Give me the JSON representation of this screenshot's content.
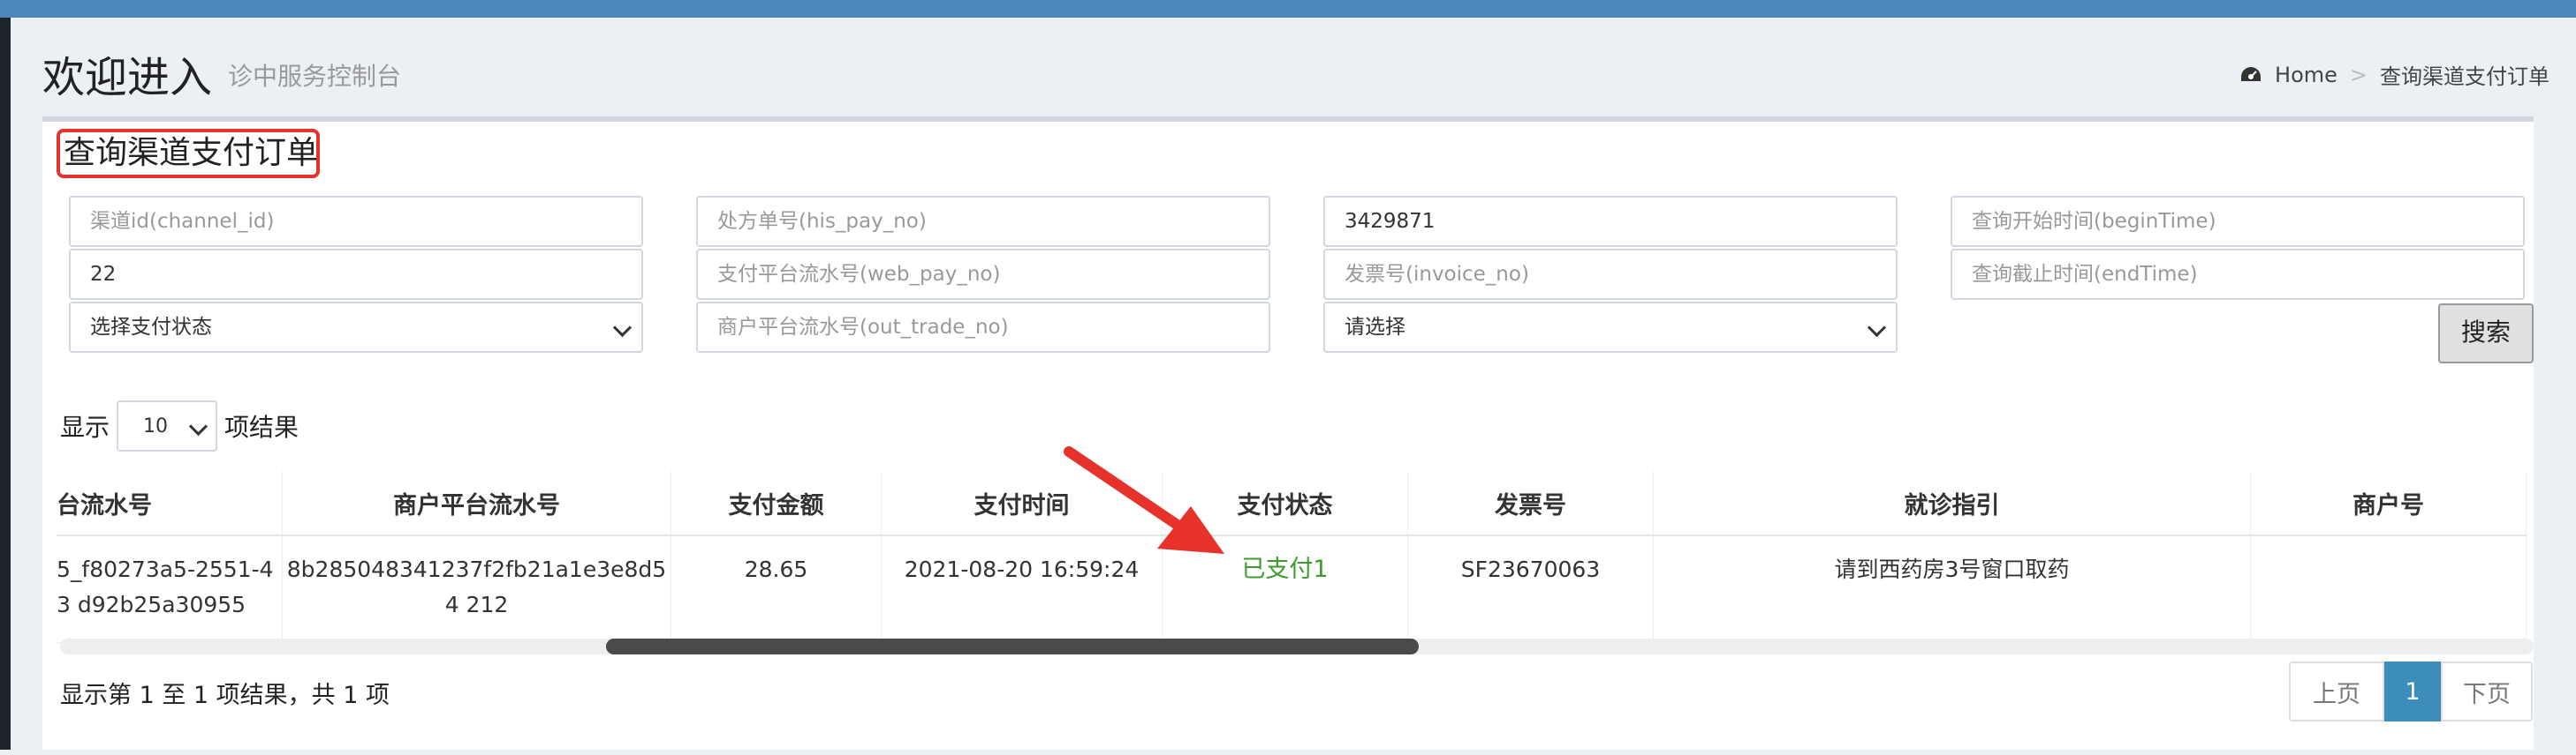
{
  "header": {
    "title": "欢迎进入",
    "subtitle": "诊中服务控制台"
  },
  "breadcrumb": {
    "home": "Home",
    "separator": ">",
    "current": "查询渠道支付订单",
    "icon": "dashboard-icon"
  },
  "box": {
    "title": "查询渠道支付订单"
  },
  "filters": {
    "channel_id": {
      "placeholder": "渠道id(channel_id)",
      "value": ""
    },
    "his_pay_no": {
      "placeholder": "处方单号(his_pay_no)",
      "value": ""
    },
    "patient_no": {
      "value": "3429871"
    },
    "begin_time": {
      "placeholder": "查询开始时间(beginTime)",
      "value": ""
    },
    "field_22": {
      "value": "22"
    },
    "web_pay_no": {
      "placeholder": "支付平台流水号(web_pay_no)",
      "value": ""
    },
    "invoice_no": {
      "placeholder": "发票号(invoice_no)",
      "value": ""
    },
    "end_time": {
      "placeholder": "查询截止时间(endTime)",
      "value": ""
    },
    "pay_status": {
      "selected": "选择支付状态"
    },
    "out_trade_no": {
      "placeholder": "商户平台流水号(out_trade_no)",
      "value": ""
    },
    "other_select": {
      "selected": "请选择"
    },
    "search_label": "搜索"
  },
  "length": {
    "prefix": "显示",
    "value": "10",
    "suffix": "项结果"
  },
  "table": {
    "headers": [
      "台流水号",
      "商户平台流水号",
      "支付金额",
      "支付时间",
      "支付状态",
      "发票号",
      "就诊指引",
      "商户号"
    ],
    "rows": [
      {
        "web_pay_no": "5_f80273a5-2551-43 d92b25a30955",
        "out_trade_no": "8b285048341237f2fb21a1e3e8d54 212",
        "amount": "28.65",
        "pay_time": "2021-08-20 16:59:24",
        "status": "已支付1",
        "invoice_no": "SF23670063",
        "guide": "请到西药房3号窗口取药",
        "merchant_no": ""
      }
    ]
  },
  "footer": {
    "info": "显示第 1 至 1 项结果，共 1 项"
  },
  "pager": {
    "prev": "上页",
    "current": "1",
    "next": "下页"
  },
  "colors": {
    "accent": "#3c8dbc",
    "highlight": "#e6322b",
    "status_green": "#3c9b2d"
  }
}
